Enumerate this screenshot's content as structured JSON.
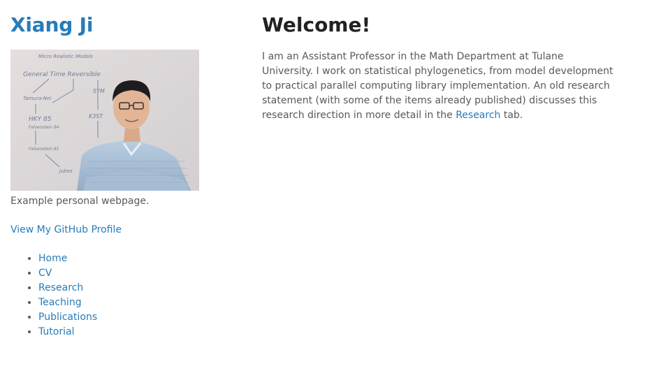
{
  "sidebar": {
    "site_title": "Xiang Ji",
    "photo_whiteboard_text": [
      "Micro Realistic Models",
      "General Time Reversible",
      "Tamura-Nei",
      "HKY 85",
      "Felsenstein 84",
      "Felsenstein 81",
      "K3ST",
      "SYM",
      "Jukes"
    ],
    "caption": "Example personal webpage.",
    "github_link": "View My GitHub Profile",
    "nav": [
      "Home",
      "CV",
      "Research",
      "Teaching",
      "Publications",
      "Tutorial"
    ]
  },
  "main": {
    "title": "Welcome!",
    "intro_text": "I am an Assistant Professor in the Math Department at Tulane University. I work on statistical phylogenetics, from model development to practical parallel computing library implementation. An old research statement (with some of the items already published) discusses this research direction in more detail in the ",
    "research_link": "Research",
    "intro_suffix": " tab."
  },
  "colors": {
    "link": "#267CB9",
    "text": "#595959",
    "heading": "#222222"
  }
}
